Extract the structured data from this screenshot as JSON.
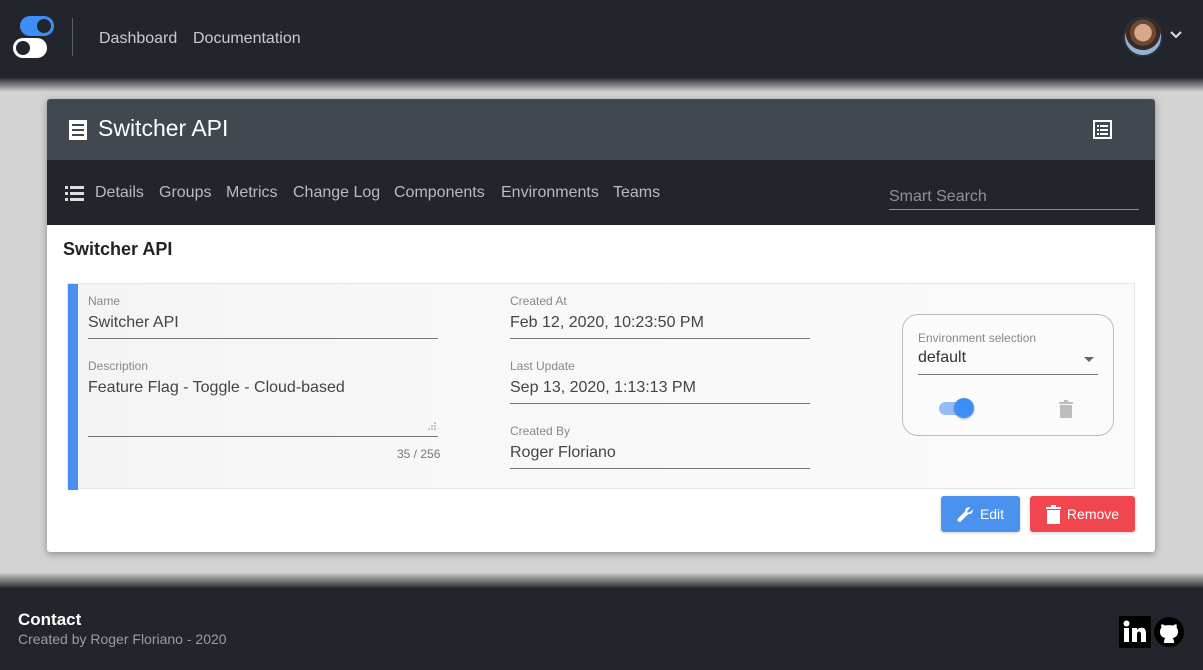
{
  "nav": {
    "links": [
      "Dashboard",
      "Documentation"
    ]
  },
  "card": {
    "title": "Switcher API",
    "tabs": [
      "Details",
      "Groups",
      "Metrics",
      "Change Log",
      "Components",
      "Environments",
      "Teams"
    ],
    "search_placeholder": "Smart Search",
    "section_title": "Switcher API"
  },
  "details": {
    "name_label": "Name",
    "name_value": "Switcher API",
    "description_label": "Description",
    "description_value": "Feature Flag - Toggle - Cloud-based",
    "description_counter": "35 / 256",
    "created_at_label": "Created At",
    "created_at_value": "Feb 12, 2020, 10:23:50 PM",
    "last_update_label": "Last Update",
    "last_update_value": "Sep 13, 2020, 1:13:13 PM",
    "created_by_label": "Created By",
    "created_by_value": "Roger Floriano"
  },
  "environment": {
    "label": "Environment selection",
    "selected": "default",
    "active": true
  },
  "actions": {
    "edit_label": "Edit",
    "remove_label": "Remove"
  },
  "footer": {
    "title": "Contact",
    "subtitle": "Created by Roger Floriano - 2020"
  },
  "icons": {
    "logo": "toggle-switch-logo",
    "card": "document-icon",
    "header_action": "list-icon",
    "tabs": "menu-icon",
    "edit": "wrench-icon",
    "remove": "trash-icon",
    "social": [
      "linkedin-icon",
      "github-icon"
    ]
  },
  "colors": {
    "accent": "#4a8ff0",
    "danger": "#f1464e",
    "dark": "#22252b",
    "header": "#424850"
  }
}
